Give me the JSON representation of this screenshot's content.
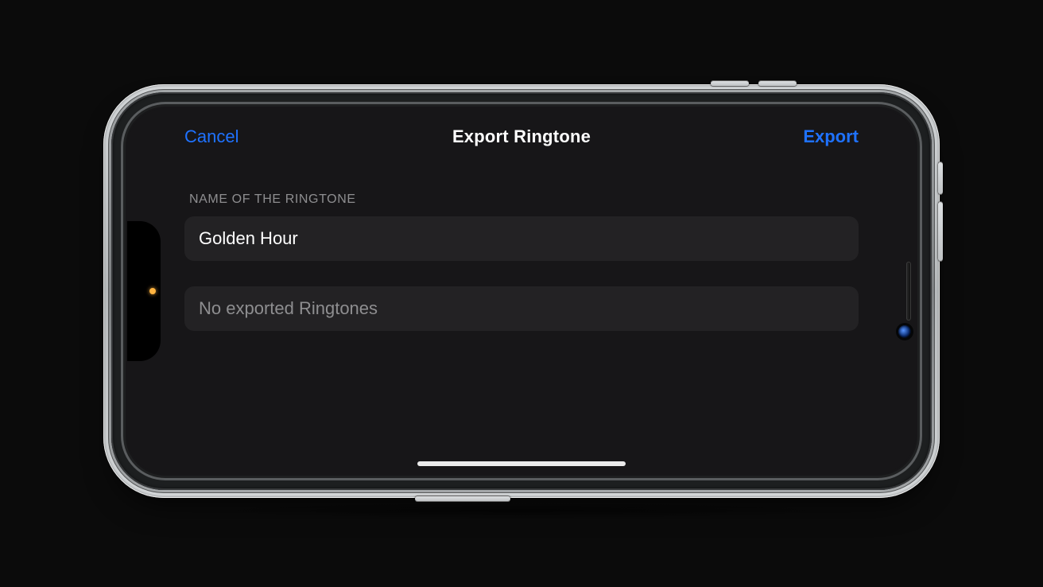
{
  "navbar": {
    "cancel_label": "Cancel",
    "title": "Export Ringtone",
    "export_label": "Export"
  },
  "form": {
    "section_header": "NAME OF THE RINGTONE",
    "ringtone_name": "Golden Hour"
  },
  "list": {
    "empty_text": "No exported Ringtones"
  },
  "colors": {
    "accent": "#1f72ff",
    "screen_bg": "#171618",
    "cell_bg": "#232224"
  }
}
